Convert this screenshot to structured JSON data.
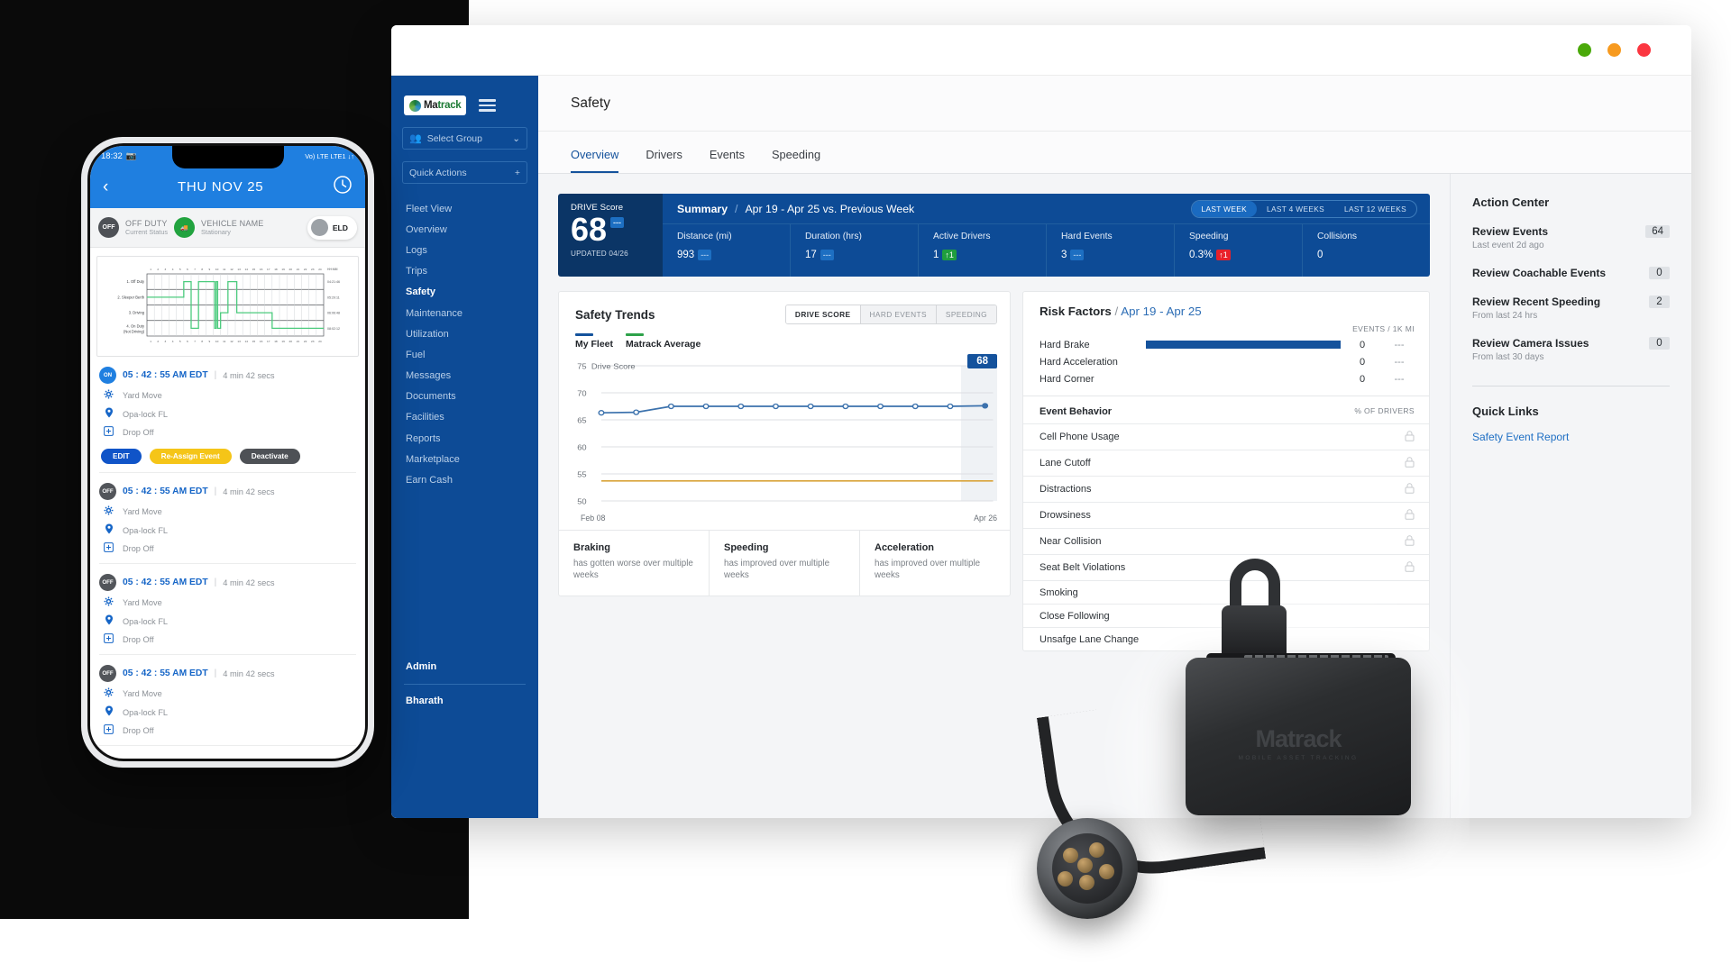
{
  "window": {
    "controls": [
      "green",
      "orange",
      "red"
    ]
  },
  "sidebar": {
    "logo": {
      "prefix": "Ma",
      "accent": "track",
      "tagline": "mobile asset tracking"
    },
    "select_group": {
      "label": "Select Group",
      "chevron": "⌄"
    },
    "quick_actions": {
      "label": "Quick Actions",
      "plus": "+"
    },
    "items": [
      {
        "label": "Fleet View",
        "active": false
      },
      {
        "label": "Overview",
        "active": false
      },
      {
        "label": "Logs",
        "active": false
      },
      {
        "label": "Trips",
        "active": false
      },
      {
        "label": "Safety",
        "active": true
      },
      {
        "label": "Maintenance",
        "active": false
      },
      {
        "label": "Utilization",
        "active": false
      },
      {
        "label": "Fuel",
        "active": false
      },
      {
        "label": "Messages",
        "active": false
      },
      {
        "label": "Documents",
        "active": false
      },
      {
        "label": "Facilities",
        "active": false
      },
      {
        "label": "Reports",
        "active": false
      },
      {
        "label": "Marketplace",
        "active": false
      },
      {
        "label": "Earn Cash",
        "active": false
      }
    ],
    "bottom": [
      {
        "label": "Admin"
      },
      {
        "label": "Bharath"
      }
    ]
  },
  "header": {
    "title": "Safety"
  },
  "tabs": [
    {
      "label": "Overview",
      "active": true
    },
    {
      "label": "Drivers",
      "active": false
    },
    {
      "label": "Events",
      "active": false
    },
    {
      "label": "Speeding",
      "active": false
    }
  ],
  "summary": {
    "score_label": "DRIVE Score",
    "score_value": "68",
    "score_trend": "---",
    "updated": "UPDATED 04/26",
    "breadcrumb_main": "Summary",
    "breadcrumb_slash": "/",
    "range": "Apr 19 - Apr 25 vs. Previous Week",
    "segments": [
      {
        "label": "LAST WEEK",
        "active": true
      },
      {
        "label": "LAST 4 WEEKS",
        "active": false
      },
      {
        "label": "LAST 12 WEEKS",
        "active": false
      }
    ],
    "metrics": [
      {
        "label": "Distance (mi)",
        "value": "993",
        "chip": "---",
        "chip_type": "neutral"
      },
      {
        "label": "Duration (hrs)",
        "value": "17",
        "chip": "---",
        "chip_type": "neutral"
      },
      {
        "label": "Active Drivers",
        "value": "1",
        "chip": "↑1",
        "chip_type": "up-green"
      },
      {
        "label": "Hard Events",
        "value": "3",
        "chip": "---",
        "chip_type": "neutral"
      },
      {
        "label": "Speeding",
        "value": "0.3%",
        "chip": "↑1",
        "chip_type": "up-red"
      },
      {
        "label": "Collisions",
        "value": "0",
        "chip": "",
        "chip_type": "none"
      }
    ]
  },
  "trends": {
    "title": "Safety Trends",
    "toggles": [
      {
        "label": "DRIVE SCORE",
        "active": true
      },
      {
        "label": "HARD EVENTS",
        "active": false
      },
      {
        "label": "SPEEDING",
        "active": false
      }
    ],
    "legend": [
      {
        "label": "My Fleet",
        "color": "#14529c"
      },
      {
        "label": "Matrack Average",
        "color": "#2ea24a"
      }
    ],
    "current_pill": "68",
    "cards": [
      {
        "title": "Braking",
        "text": "has gotten worse over multiple weeks"
      },
      {
        "title": "Speeding",
        "text": "has improved over multiple weeks"
      },
      {
        "title": "Acceleration",
        "text": "has improved over multiple weeks"
      }
    ]
  },
  "chart_data": {
    "type": "line",
    "title": "Safety Trends",
    "ylabel": "Drive Score",
    "axis_label_inline": "75 Drive Score",
    "xlabel": "",
    "x": [
      "Feb 08",
      "",
      "",
      "",
      "",
      "",
      "",
      "",
      "",
      "",
      "",
      "Apr 26"
    ],
    "xtick_labels": [
      "Feb 08",
      "Apr 26"
    ],
    "ytick_labels": [
      "75",
      "70",
      "65",
      "60",
      "55",
      "50"
    ],
    "ylim": [
      50,
      75
    ],
    "grid": true,
    "legend_position": "top-left",
    "highlight_band": {
      "label": "68",
      "at_index": 11
    },
    "series": [
      {
        "name": "My Fleet",
        "color": "#3c72ad",
        "values": [
          66.3,
          66.4,
          67.5,
          67.5,
          67.5,
          67.5,
          67.5,
          67.5,
          67.5,
          67.5,
          67.5,
          67.6
        ]
      },
      {
        "name": "Matrack Average",
        "color": "#d9a43a",
        "values": [
          53.7,
          53.7,
          53.7,
          53.7,
          53.7,
          53.7,
          53.7,
          53.7,
          53.7,
          53.7,
          53.7,
          53.7
        ]
      }
    ]
  },
  "risk": {
    "title_bold": "Risk Factors",
    "title_slash": "/",
    "title_range": "Apr 19 - Apr 25",
    "col_header": "EVENTS / 1K MI",
    "rows": [
      {
        "name": "Hard Brake",
        "bar_pct": 100,
        "value": "0",
        "delta": "---"
      },
      {
        "name": "Hard Acceleration",
        "bar_pct": 0,
        "value": "0",
        "delta": "---"
      },
      {
        "name": "Hard Corner",
        "bar_pct": 0,
        "value": "0",
        "delta": "---"
      }
    ],
    "behavior_title": "Event Behavior",
    "behavior_col": "% OF DRIVERS",
    "behaviors": [
      {
        "name": "Cell Phone Usage",
        "locked": true
      },
      {
        "name": "Lane Cutoff",
        "locked": true
      },
      {
        "name": "Distractions",
        "locked": true
      },
      {
        "name": "Drowsiness",
        "locked": true
      },
      {
        "name": "Near Collision",
        "locked": true
      },
      {
        "name": "Seat Belt Violations",
        "locked": true
      },
      {
        "name": "Smoking",
        "locked": false
      },
      {
        "name": "Close Following",
        "locked": false
      },
      {
        "name": "Unsafge Lane Change",
        "locked": false
      }
    ]
  },
  "action_center": {
    "title": "Action Center",
    "items": [
      {
        "name": "Review Events",
        "sub": "Last event 2d ago",
        "count": "64"
      },
      {
        "name": "Review Coachable Events",
        "sub": "",
        "count": "0"
      },
      {
        "name": "Review Recent Speeding",
        "sub": "From last 24 hrs",
        "count": "2"
      },
      {
        "name": "Review Camera Issues",
        "sub": "From last 30 days",
        "count": "0"
      }
    ],
    "quick_links_title": "Quick Links",
    "quick_links": [
      {
        "label": "Safety Event Report"
      }
    ]
  },
  "phone": {
    "status": {
      "time": "18:32",
      "right": "Vo) LTE  LTE1 ↓↑"
    },
    "appbar": {
      "back": "‹",
      "title": "THU  NOV 25",
      "clock": "clock"
    },
    "status_row": {
      "duty_badge": "OFF",
      "duty_title": "OFF DUTY",
      "duty_sub": "Current Status",
      "vehicle_title": "VEHICLE NAME",
      "vehicle_sub": "Stationary",
      "eld": "ELD"
    },
    "graph": {
      "hours": [
        "1",
        "2",
        "3",
        "4",
        "5",
        "6",
        "7",
        "8",
        "9",
        "10",
        "11",
        "12",
        "13",
        "14",
        "15",
        "16",
        "17",
        "18",
        "19",
        "20",
        "21",
        "22",
        "23",
        "24"
      ],
      "rows": [
        "1. Off Duty",
        "2. Sleeper Berth",
        "3. Driving",
        "4. On Duty (Not Driving)"
      ],
      "totals_header": "HH:MM",
      "totals": [
        "04:21:46",
        "05:29:11",
        "06:06:48",
        "08:02:12"
      ]
    },
    "entries": [
      {
        "badge": "ON",
        "badge_type": "on",
        "time": "05 : 42 : 55 AM EDT",
        "duration": "4 min 42 secs",
        "rows": [
          {
            "icon": "gear-icon",
            "text": "Yard Move"
          },
          {
            "icon": "pin-icon",
            "text": "Opa-lock FL"
          },
          {
            "icon": "box-icon",
            "text": "Drop Off"
          }
        ],
        "buttons": [
          {
            "label": "EDIT",
            "type": "edit"
          },
          {
            "label": "Re-Assign Event",
            "type": "reassign"
          },
          {
            "label": "Deactivate",
            "type": "deact"
          }
        ]
      },
      {
        "badge": "OFF",
        "badge_type": "off",
        "time": "05 : 42 : 55 AM EDT",
        "duration": "4 min 42 secs",
        "rows": [
          {
            "icon": "gear-icon",
            "text": "Yard Move"
          },
          {
            "icon": "pin-icon",
            "text": "Opa-lock FL"
          },
          {
            "icon": "box-icon",
            "text": "Drop Off"
          }
        ],
        "buttons": []
      },
      {
        "badge": "OFF",
        "badge_type": "off",
        "time": "05 : 42 : 55 AM EDT",
        "duration": "4 min 42 secs",
        "rows": [
          {
            "icon": "gear-icon",
            "text": "Yard Move"
          },
          {
            "icon": "pin-icon",
            "text": "Opa-lock FL"
          },
          {
            "icon": "box-icon",
            "text": "Drop Off"
          }
        ],
        "buttons": []
      },
      {
        "badge": "OFF",
        "badge_type": "off",
        "time": "05 : 42 : 55 AM EDT",
        "duration": "4 min 42 secs",
        "rows": [
          {
            "icon": "gear-icon",
            "text": "Yard Move"
          },
          {
            "icon": "pin-icon",
            "text": "Opa-lock FL"
          },
          {
            "icon": "box-icon",
            "text": "Drop Off"
          }
        ],
        "buttons": []
      }
    ]
  },
  "device": {
    "brand": "Matrack",
    "tagline": "MOBILE ASSET TRACKING"
  }
}
